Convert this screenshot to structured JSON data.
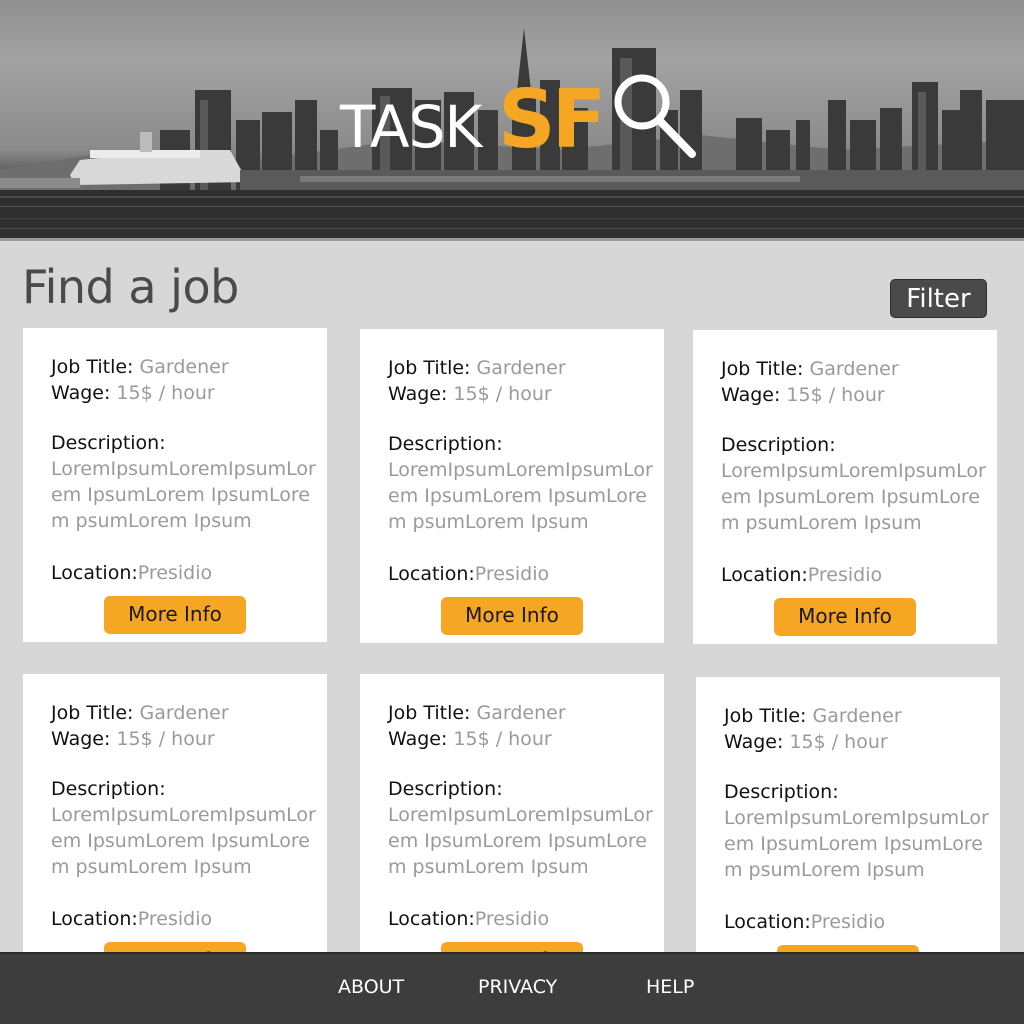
{
  "header": {
    "logo_task": "TASK",
    "logo_sf": "SF",
    "accent_color": "#f5a623"
  },
  "main": {
    "title": "Find a job",
    "filter_label": "Filter"
  },
  "card_labels": {
    "job_title": "Job Title:",
    "wage": "Wage:",
    "description": "Description:",
    "location": "Location:",
    "more_info": "More Info"
  },
  "jobs": [
    {
      "title": "Gardener",
      "wage": "15$ / hour",
      "description": "LoremIpsumLoremIpsumLorem IpsumLorem IpsumLorem psumLorem Ipsum",
      "location": "Presidio"
    },
    {
      "title": "Gardener",
      "wage": "15$ / hour",
      "description": "LoremIpsumLoremIpsumLorem IpsumLorem IpsumLorem psumLorem Ipsum",
      "location": "Presidio"
    },
    {
      "title": "Gardener",
      "wage": "15$ / hour",
      "description": "LoremIpsumLoremIpsumLorem IpsumLorem IpsumLorem psumLorem Ipsum",
      "location": "Presidio"
    },
    {
      "title": "Gardener",
      "wage": "15$ / hour",
      "description": "LoremIpsumLoremIpsumLorem IpsumLorem IpsumLorem psumLorem Ipsum",
      "location": "Presidio"
    },
    {
      "title": "Gardener",
      "wage": "15$ / hour",
      "description": "LoremIpsumLoremIpsumLorem IpsumLorem IpsumLorem psumLorem Ipsum",
      "location": "Presidio"
    },
    {
      "title": "Gardener",
      "wage": "15$ / hour",
      "description": "LoremIpsumLoremIpsumLorem IpsumLorem IpsumLorem psumLorem Ipsum",
      "location": "Presidio"
    }
  ],
  "footer": {
    "links": [
      "ABOUT",
      "PRIVACY",
      "HELP"
    ]
  }
}
